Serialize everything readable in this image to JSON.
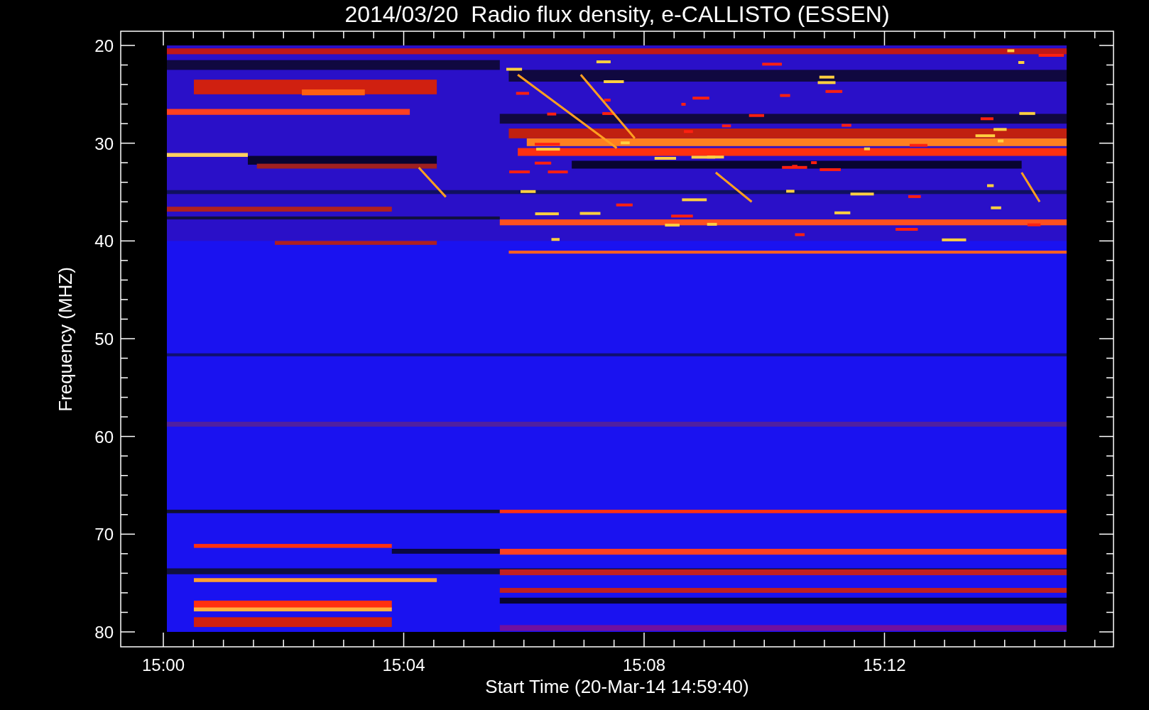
{
  "title": "2014/03/20  Radio flux density, e-CALLISTO (ESSEN)",
  "y_axis": {
    "label": "Frequency (MHZ)",
    "ticks": [
      "20",
      "30",
      "40",
      "50",
      "60",
      "70",
      "80"
    ]
  },
  "x_axis": {
    "label": "Start Time (20-Mar-14 14:59:40)",
    "ticks": [
      "15:00",
      "15:04",
      "15:08",
      "15:12"
    ]
  }
}
